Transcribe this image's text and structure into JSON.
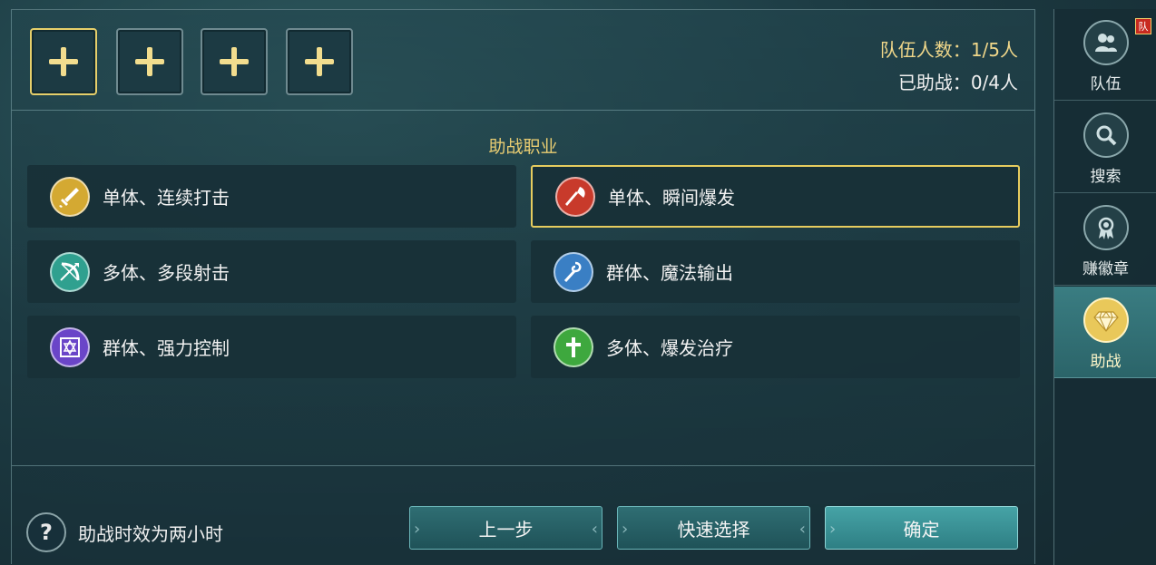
{
  "slots": [
    {
      "selected": true
    },
    {
      "selected": false
    },
    {
      "selected": false
    },
    {
      "selected": false
    }
  ],
  "team_info": {
    "team_count_label": "队伍人数：",
    "team_count_value": "1/5人",
    "assisted_label": "已助战：",
    "assisted_value": "0/4人"
  },
  "section_title": "助战职业",
  "classes": [
    {
      "label": "单体、连续打击",
      "icon": "sword-icon",
      "color": "#d4a932"
    },
    {
      "label": "单体、瞬间爆发",
      "icon": "axe-icon",
      "color": "#c83a2b",
      "selected": true
    },
    {
      "label": "多体、多段射击",
      "icon": "bow-icon",
      "color": "#2fa08f"
    },
    {
      "label": "群体、魔法输出",
      "icon": "staff-icon",
      "color": "#3a7fc4"
    },
    {
      "label": "群体、强力控制",
      "icon": "hexagram-icon",
      "color": "#6a45c8"
    },
    {
      "label": "多体、爆发治疗",
      "icon": "cross-icon",
      "color": "#3ea83e"
    }
  ],
  "footer": {
    "help_text": "助战时效为两小时",
    "prev_label": "上一步",
    "quick_label": "快速选择",
    "confirm_label": "确定"
  },
  "sidebar": {
    "tabs": [
      {
        "label": "队伍",
        "icon": "team-icon",
        "badge": "队"
      },
      {
        "label": "搜索",
        "icon": "search-icon"
      },
      {
        "label": "赚徽章",
        "icon": "medal-icon"
      },
      {
        "label": "助战",
        "icon": "diamond-icon",
        "active": true
      }
    ]
  }
}
